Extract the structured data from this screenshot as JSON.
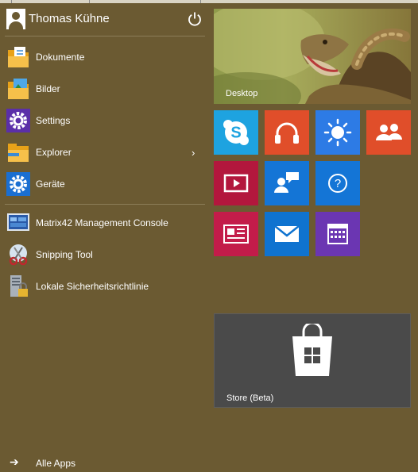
{
  "user": {
    "name": "Thomas Kühne"
  },
  "left_items": [
    {
      "label": "Dokumente"
    },
    {
      "label": "Bilder"
    },
    {
      "label": "Settings"
    },
    {
      "label": "Explorer"
    },
    {
      "label": "Geräte"
    }
  ],
  "recent_items": [
    {
      "label": "Matrix42 Management Console"
    },
    {
      "label": "Snipping Tool"
    },
    {
      "label": "Lokale Sicherheitsrichtlinie"
    }
  ],
  "all_apps": {
    "label": "Alle Apps"
  },
  "tiles": {
    "desktop": {
      "label": "Desktop"
    },
    "store": {
      "label": "Store (Beta)"
    },
    "small": [
      {
        "icon": "skype-icon",
        "color": "#1ea3e0"
      },
      {
        "icon": "headphones-icon",
        "color": "#e04e2a"
      },
      {
        "icon": "weather-sun-icon",
        "color": "#2d7be5"
      },
      {
        "icon": "people-icon",
        "color": "#e04e2a"
      },
      {
        "icon": "video-icon",
        "color": "#b3173d"
      },
      {
        "icon": "feedback-chat-icon",
        "color": "#1475d6"
      },
      {
        "icon": "help-icon",
        "color": "#1475d6"
      },
      {
        "icon": "news-icon",
        "color": "#c31c4a"
      },
      {
        "icon": "mail-icon",
        "color": "#0f73d0"
      },
      {
        "icon": "calendar-icon",
        "color": "#6b36b2"
      }
    ]
  },
  "colors": {
    "background": "#6b5a32"
  }
}
